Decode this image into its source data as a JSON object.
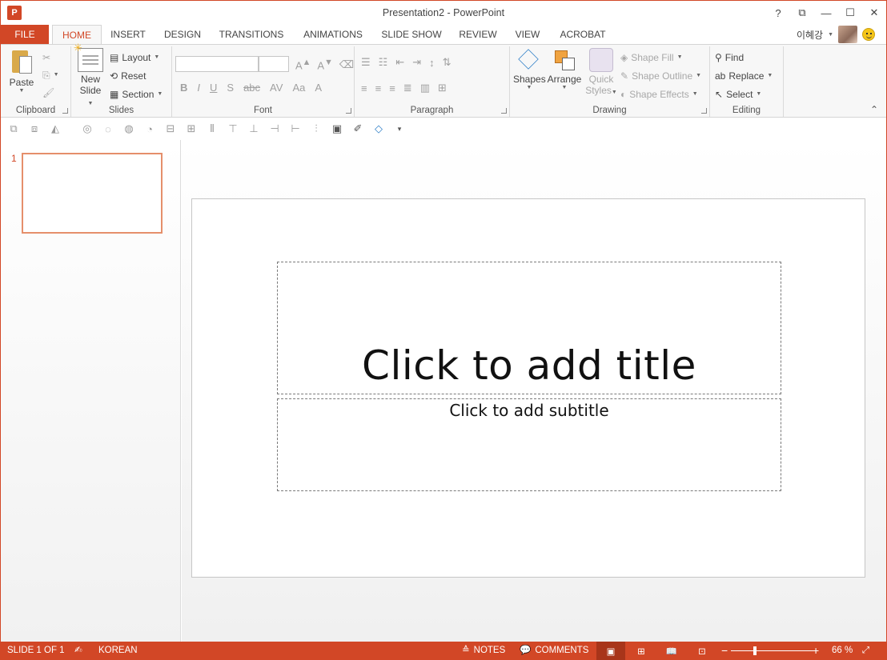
{
  "window": {
    "title": "Presentation2 - PowerPoint",
    "app_icon_letter": "P",
    "controls": {
      "help": "?",
      "ribbon_display": "⧉",
      "minimize": "—",
      "maximize": "☐",
      "close": "✕"
    }
  },
  "tabs": [
    {
      "label": "FILE"
    },
    {
      "label": "HOME"
    },
    {
      "label": "INSERT"
    },
    {
      "label": "DESIGN"
    },
    {
      "label": "TRANSITIONS"
    },
    {
      "label": "ANIMATIONS"
    },
    {
      "label": "SLIDE SHOW"
    },
    {
      "label": "REVIEW"
    },
    {
      "label": "VIEW"
    },
    {
      "label": "ACROBAT"
    }
  ],
  "user": {
    "name": "이혜강"
  },
  "ribbon": {
    "clipboard": {
      "label": "Clipboard",
      "paste": "Paste"
    },
    "slides": {
      "label": "Slides",
      "new_slide_1": "New",
      "new_slide_2": "Slide",
      "layout": "Layout",
      "reset": "Reset",
      "section": "Section"
    },
    "font": {
      "label": "Font"
    },
    "paragraph": {
      "label": "Paragraph"
    },
    "drawing": {
      "label": "Drawing",
      "shapes": "Shapes",
      "arrange": "Arrange",
      "quick_styles_1": "Quick",
      "quick_styles_2": "Styles",
      "shape_fill": "Shape Fill",
      "shape_outline": "Shape Outline",
      "shape_effects": "Shape Effects"
    },
    "editing": {
      "label": "Editing",
      "find": "Find",
      "replace": "Replace",
      "select": "Select"
    }
  },
  "thumbnails": [
    {
      "number": "1"
    }
  ],
  "slide": {
    "title_placeholder": "Click to add title",
    "subtitle_placeholder": "Click to add subtitle"
  },
  "statusbar": {
    "slide_info": "SLIDE 1 OF 1",
    "language": "KOREAN",
    "notes": "NOTES",
    "comments": "COMMENTS",
    "zoom_minus": "−",
    "zoom_plus": "+",
    "zoom": "66 %"
  },
  "colors": {
    "accent": "#d24726",
    "thumb_border": "#e58f6b"
  }
}
